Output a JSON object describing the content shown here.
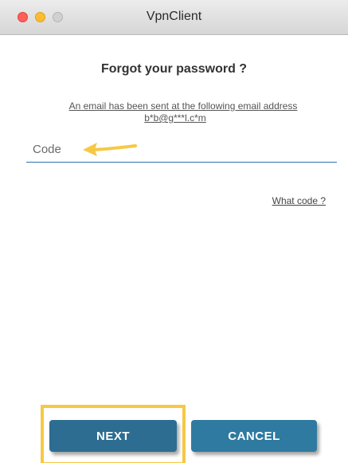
{
  "window": {
    "title": "VpnClient"
  },
  "form": {
    "heading": "Forgot your password ?",
    "notice_line1": "An email has been sent at the following email address",
    "notice_line2": "b*b@g***l.c*m",
    "code_placeholder": "Code",
    "code_value": "",
    "what_code_link": "What code ?"
  },
  "buttons": {
    "next_label": "NEXT",
    "cancel_label": "CANCEL"
  },
  "colors": {
    "annotation": "#f7c843",
    "next_button": "#2d6d91",
    "cancel_button": "#2f7aa0",
    "input_underline": "#2e6fb8"
  }
}
